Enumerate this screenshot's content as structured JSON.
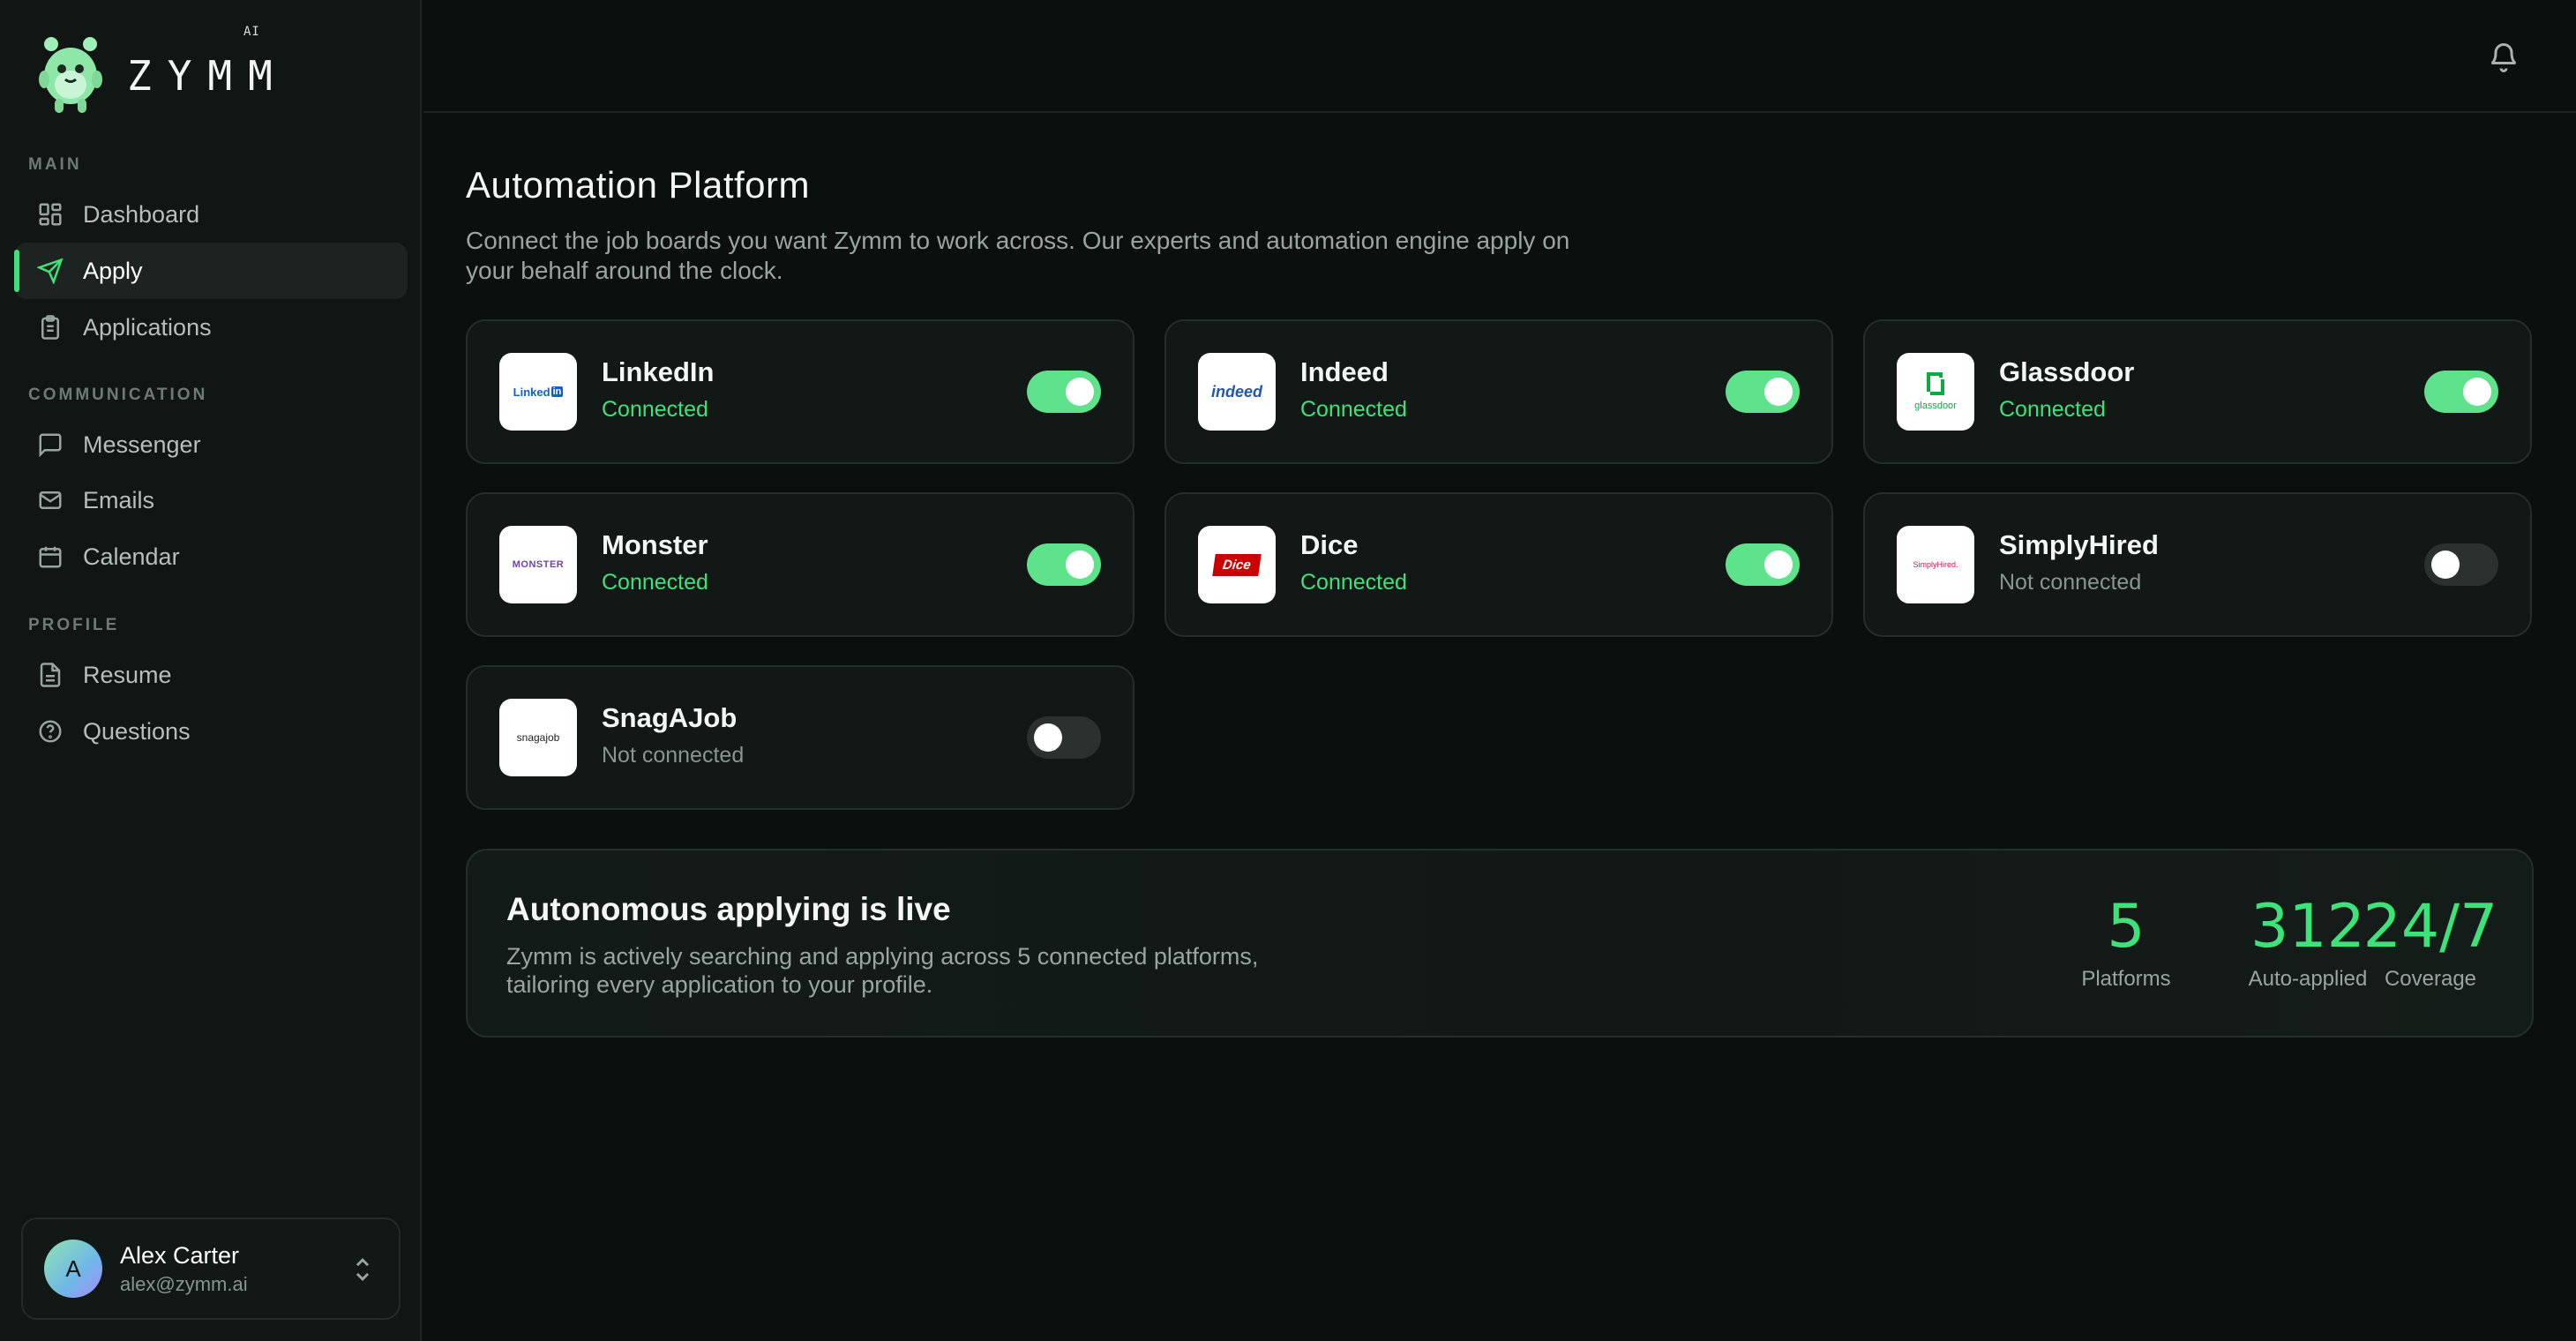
{
  "brand": {
    "name": "ZYMM",
    "suffix": "AI"
  },
  "sidebar": {
    "sections": [
      {
        "label": "MAIN"
      },
      {
        "label": "COMMUNICATION"
      },
      {
        "label": "PROFILE"
      }
    ],
    "items": [
      {
        "label": "Dashboard",
        "icon": "grid-icon"
      },
      {
        "label": "Apply",
        "icon": "send-icon",
        "active": true
      },
      {
        "label": "Applications",
        "icon": "clipboard-icon"
      },
      {
        "label": "Messenger",
        "icon": "chat-icon"
      },
      {
        "label": "Emails",
        "icon": "mail-icon"
      },
      {
        "label": "Calendar",
        "icon": "calendar-icon"
      },
      {
        "label": "Resume",
        "icon": "document-icon"
      },
      {
        "label": "Questions",
        "icon": "help-circle-icon"
      }
    ]
  },
  "user": {
    "initial": "A",
    "name": "Alex Carter",
    "email": "alex@zymm.ai"
  },
  "header": {
    "notifications_icon": "bell-icon"
  },
  "page": {
    "title": "Automation Platform",
    "description": "Connect the job boards you want Zymm to work across. Our experts and automation engine apply on your behalf around the clock."
  },
  "platforms": [
    {
      "name": "LinkedIn",
      "logo_text": "Linked",
      "logo_badge": "in",
      "status": "Connected",
      "connected": true
    },
    {
      "name": "Indeed",
      "logo_text": "indeed",
      "status": "Connected",
      "connected": true
    },
    {
      "name": "Glassdoor",
      "logo_text": "glassdoor",
      "status": "Connected",
      "connected": true
    },
    {
      "name": "Monster",
      "logo_text": "MONSTER",
      "status": "Connected",
      "connected": true
    },
    {
      "name": "Dice",
      "logo_text": "Dice",
      "status": "Connected",
      "connected": true
    },
    {
      "name": "SimplyHired",
      "logo_text": "SimplyHired.",
      "status": "Not connected",
      "connected": false
    },
    {
      "name": "SnagAJob",
      "logo_text": "snagajob",
      "status": "Not connected",
      "connected": false
    }
  ],
  "live": {
    "title": "Autonomous applying is live",
    "description": "Zymm is actively searching and applying across 5 connected platforms, tailoring every application to your profile.",
    "stats": [
      {
        "value": "5",
        "label": "Platforms"
      },
      {
        "value": "312",
        "label": "Auto-applied"
      },
      {
        "value": "24/7",
        "label": "Coverage"
      }
    ]
  },
  "colors": {
    "accent": "#3ee27a",
    "toggle_on": "#5fe28c",
    "background": "#0b0f0e",
    "panel": "#111615"
  }
}
